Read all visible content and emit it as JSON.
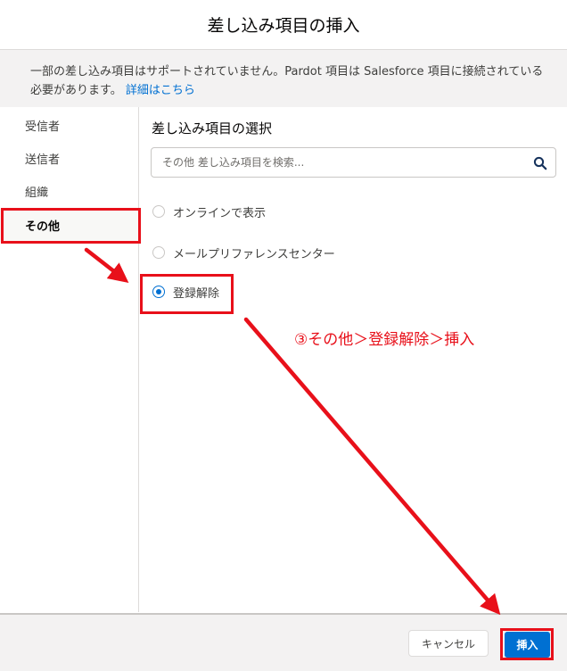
{
  "dialog": {
    "title": "差し込み項目の挿入"
  },
  "notice": {
    "text": "一部の差し込み項目はサポートされていません。Pardot 項目は Salesforce 項目に接続されている必要があります。",
    "link": "詳細はこちら"
  },
  "sidebar": {
    "items": [
      {
        "label": "受信者"
      },
      {
        "label": "送信者"
      },
      {
        "label": "組織"
      },
      {
        "label": "その他",
        "active": true
      }
    ]
  },
  "main": {
    "section_title": "差し込み項目の選択",
    "search": {
      "placeholder": "その他 差し込み項目を検索...",
      "value": ""
    },
    "options": [
      {
        "label": "オンラインで表示",
        "checked": false
      },
      {
        "label": "メールプリファレンスセンター",
        "checked": false
      },
      {
        "label": "登録解除",
        "checked": true
      }
    ]
  },
  "footer": {
    "cancel_label": "キャンセル",
    "insert_label": "挿入"
  },
  "annotation": {
    "text": "③その他＞登録解除＞挿入",
    "color": "#e8101a"
  },
  "colors": {
    "brand": "#0070d2",
    "annotation_red": "#e8101a"
  },
  "icons": {
    "search": "search-icon"
  }
}
